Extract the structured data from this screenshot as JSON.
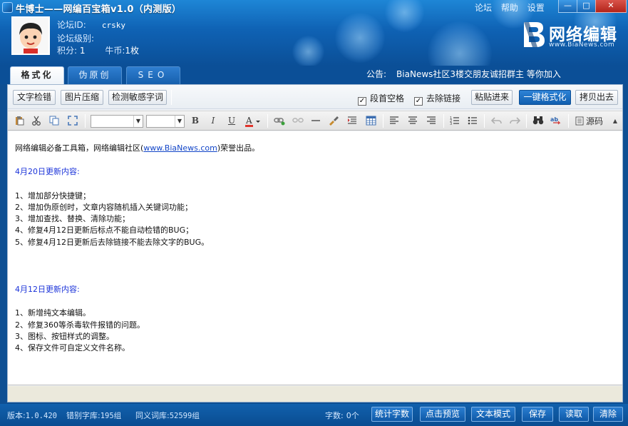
{
  "window": {
    "title": "牛博士——网编百宝箱v1.0（内测版）",
    "links": [
      "论坛",
      "帮助",
      "设置"
    ],
    "minimize": "—",
    "maximize": "□",
    "close": "✕"
  },
  "user": {
    "forum_id_label": "论坛ID:",
    "forum_id": "crsky",
    "level_label": "论坛级别:",
    "points_label": "积分:",
    "points": "1",
    "coins_label": "牛币:",
    "coins": "1枚"
  },
  "logo": {
    "name": "网络编辑",
    "url": "www.BiaNews.com"
  },
  "tabs": [
    {
      "label": "格式化",
      "active": true
    },
    {
      "label": "伪原创",
      "active": false
    },
    {
      "label": "SEO",
      "active": false
    }
  ],
  "notice": {
    "label": "公告:",
    "text": "BiaNews社区3楼交朋友诚招群主 等你加入"
  },
  "actions": {
    "text_check": "文字检错",
    "image_compress": "图片压缩",
    "sensitive_check": "检测敏感字词",
    "indent_label": "段首空格",
    "indent_checked": true,
    "remove_links_label": "去除链接",
    "remove_links_checked": true,
    "paste_in": "粘贴进来",
    "format_all": "一键格式化",
    "copy_out": "拷贝出去"
  },
  "toolbar": {
    "source_label": "源码"
  },
  "editor": {
    "intro_prefix": "网络编辑必备工具箱，网络编辑社区(",
    "intro_link": "www.BiaNews.com",
    "intro_suffix": ")荣誉出品。",
    "section1_title": "4月20日更新内容:",
    "section1_items": [
      "1、增加部分快捷键；",
      "2、增加伪原创时，文章内容随机插入关键词功能；",
      "3、增加查找、替换、清除功能；",
      "4、修复4月12日更新后标点不能自动检错的BUG；",
      "5、修复4月12日更新后去除链接不能去除文字的BUG。"
    ],
    "section2_title": "4月12日更新内容:",
    "section2_items": [
      "1、新增纯文本编辑。",
      "2、修复360等杀毒软件报错的问题。",
      "3、图标、按钮样式的调整。",
      "4、保存文件可自定义文件名称。"
    ]
  },
  "footer": {
    "version_label": "版本:",
    "version": "1.0.420",
    "error_dict_label": "错别字库:",
    "error_dict": "195组",
    "synonym_label": "同义词库:",
    "synonym": "52599组",
    "char_count_label": "字数:",
    "char_count": "0个",
    "btn_count": "统计字数",
    "btn_preview": "点击预览",
    "btn_text_mode": "文本模式",
    "btn_save": "保存",
    "btn_read": "读取",
    "btn_clear": "清除"
  },
  "colors": {
    "header_blue": "#0f62b4",
    "panel_bg": "#eef1f5",
    "editor_heading": "#1b33d9",
    "primary_button": "#115fb0"
  }
}
